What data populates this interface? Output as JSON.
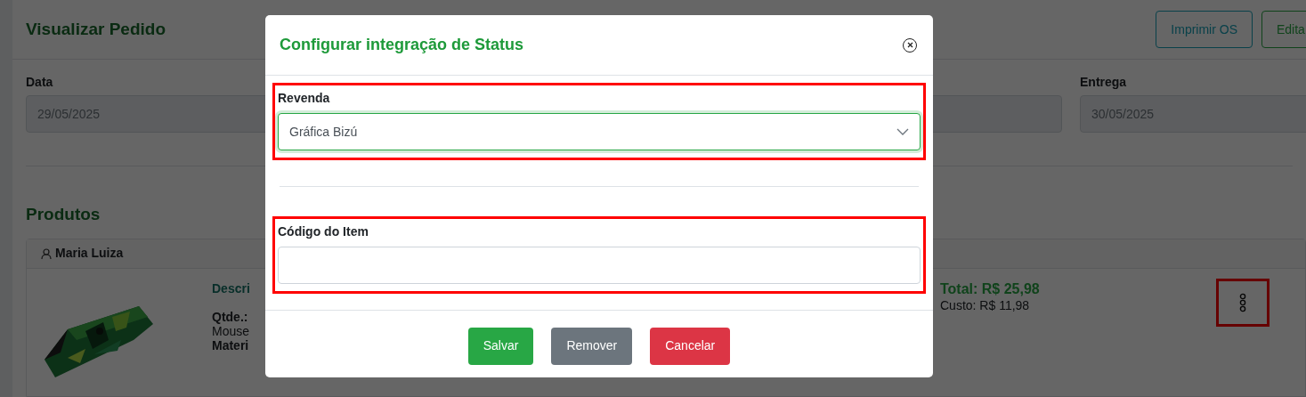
{
  "page": {
    "title": "Visualizar Pedido",
    "buttons": [
      {
        "label": "Imprimir OS",
        "kind": "info"
      },
      {
        "label": "Edita",
        "kind": "success"
      }
    ],
    "fields": [
      {
        "label": "Data",
        "value": "29/05/2025"
      },
      {
        "label": "Entrega",
        "value": "30/05/2025"
      }
    ]
  },
  "products": {
    "heading": "Produtos",
    "items": [
      {
        "customer": "Maria Luiza",
        "description_label": "Descri",
        "qty_label": "Qtde.:",
        "name": "Mouse",
        "material_label": "Materi",
        "total": "Total: R$ 25,98",
        "cost": "Custo: R$ 11,98",
        "menu_highlighted": true
      }
    ]
  },
  "modal": {
    "title": "Configurar integração de Status",
    "fields": [
      {
        "kind": "select",
        "label": "Revenda",
        "value": "Gráfica Bizú",
        "focused": true,
        "highlighted": true
      },
      {
        "kind": "text",
        "label": "Código do Item",
        "focused": false,
        "highlighted": true
      }
    ],
    "buttons": [
      {
        "label": "Salvar",
        "kind": "success"
      },
      {
        "label": "Remover",
        "kind": "secondary"
      },
      {
        "label": "Cancelar",
        "kind": "danger"
      }
    ]
  }
}
